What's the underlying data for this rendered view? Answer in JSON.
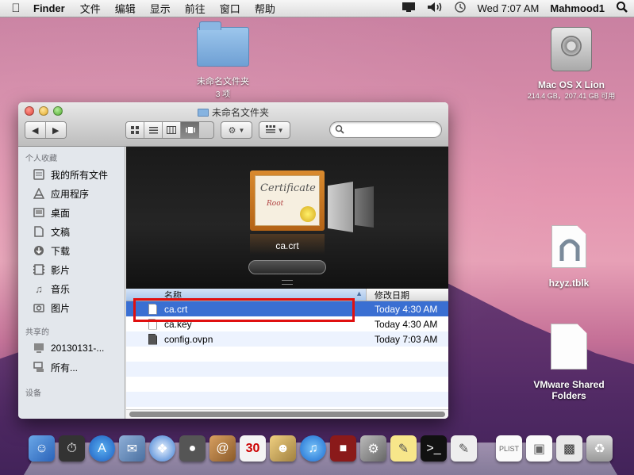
{
  "menubar": {
    "app_name": "Finder",
    "menus": [
      "文件",
      "编辑",
      "显示",
      "前往",
      "窗口",
      "帮助"
    ],
    "clock": "Wed 7:07 AM",
    "user": "Mahmood1"
  },
  "desktop": {
    "folder": {
      "name": "未命名文件夹",
      "subtitle": "3 项"
    },
    "drive": {
      "name": "Mac OS X Lion",
      "subtitle": "214.4 GB，207.41 GB 可用"
    },
    "tblk": {
      "name": "hzyz.tblk"
    },
    "vmware": {
      "name": "VMware Shared Folders"
    }
  },
  "window": {
    "title": "未命名文件夹",
    "sidebar": {
      "favorites_header": "个人收藏",
      "favorites": [
        {
          "label": "我的所有文件",
          "icon": "all-files-icon"
        },
        {
          "label": "应用程序",
          "icon": "applications-icon"
        },
        {
          "label": "桌面",
          "icon": "desktop-icon"
        },
        {
          "label": "文稿",
          "icon": "documents-icon"
        },
        {
          "label": "下载",
          "icon": "downloads-icon"
        },
        {
          "label": "影片",
          "icon": "movies-icon"
        },
        {
          "label": "音乐",
          "icon": "music-icon"
        },
        {
          "label": "图片",
          "icon": "pictures-icon"
        }
      ],
      "shared_header": "共享的",
      "shared": [
        {
          "label": "20130131-...",
          "icon": "computer-icon"
        },
        {
          "label": "所有...",
          "icon": "network-icon"
        }
      ],
      "devices_header": "设备"
    },
    "coverflow": {
      "selected_label": "ca.crt",
      "cert_title": "Certificate",
      "cert_subtitle": "Root"
    },
    "list": {
      "col_name": "名称",
      "col_date": "修改日期",
      "rows": [
        {
          "name": "ca.crt",
          "date": "Today 4:30 AM",
          "selected": true
        },
        {
          "name": "ca.key",
          "date": "Today 4:30 AM",
          "selected": false
        },
        {
          "name": "config.ovpn",
          "date": "Today 7:03 AM",
          "selected": false
        }
      ]
    }
  },
  "colors": {
    "selection": "#3a6fd2",
    "highlight_box": "#e01010"
  }
}
